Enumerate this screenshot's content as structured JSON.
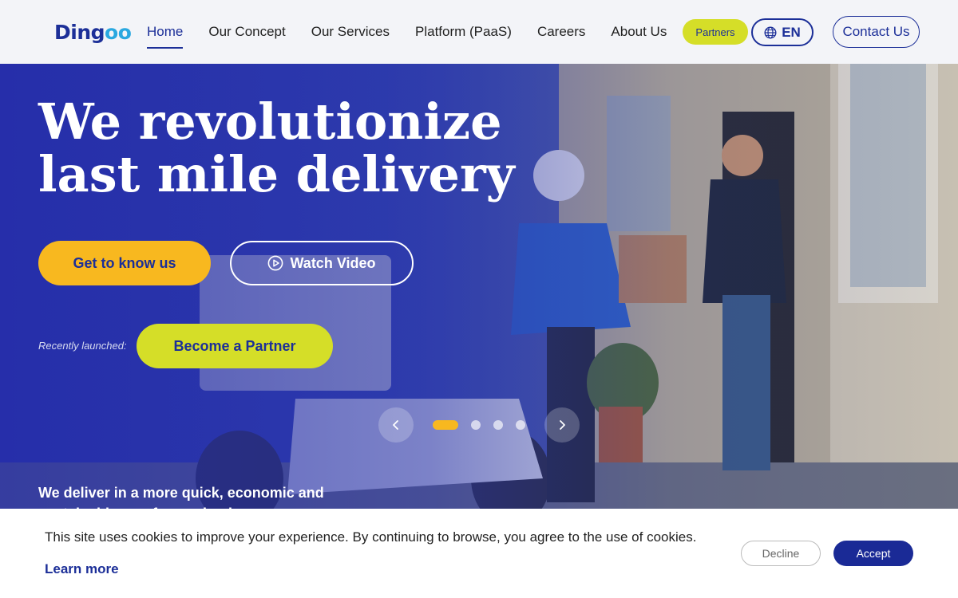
{
  "header": {
    "logo": "Dingoo",
    "nav": [
      {
        "label": "Home",
        "active": true
      },
      {
        "label": "Our Concept",
        "active": false
      },
      {
        "label": "Our Services",
        "active": false
      },
      {
        "label": "Platform (PaaS)",
        "active": false
      },
      {
        "label": "Careers",
        "active": false
      },
      {
        "label": "About Us",
        "active": false
      }
    ],
    "partners_label": "Partners",
    "language_label": "EN",
    "language_icon": "globe-icon",
    "contact_label": "Contact Us"
  },
  "hero": {
    "headline_line1": "We revolutionize",
    "headline_line2": "last mile delivery",
    "get_to_know_label": "Get to know us",
    "watch_video_label": "Watch Video",
    "watch_video_icon": "play-circle-icon",
    "recently_launched": "Recently launched:",
    "become_partner_label": "Become a Partner",
    "tagline": "We deliver in a more quick, economic and sustainable way for our business partners.",
    "carousel": {
      "slide_count": 4,
      "active_slide": 1,
      "prev_icon": "chevron-left-icon",
      "next_icon": "chevron-right-icon"
    }
  },
  "cookie": {
    "message": "This site uses cookies to improve your experience. By continuing to browse, you agree to the use of cookies.",
    "learn_more": "Learn more",
    "decline_label": "Decline",
    "accept_label": "Accept"
  },
  "colors": {
    "brand_blue": "#1c2f98",
    "accent_yellow": "#f8b81f",
    "accent_lime": "#d5de28",
    "hero_overlay": "#2a35a8"
  }
}
